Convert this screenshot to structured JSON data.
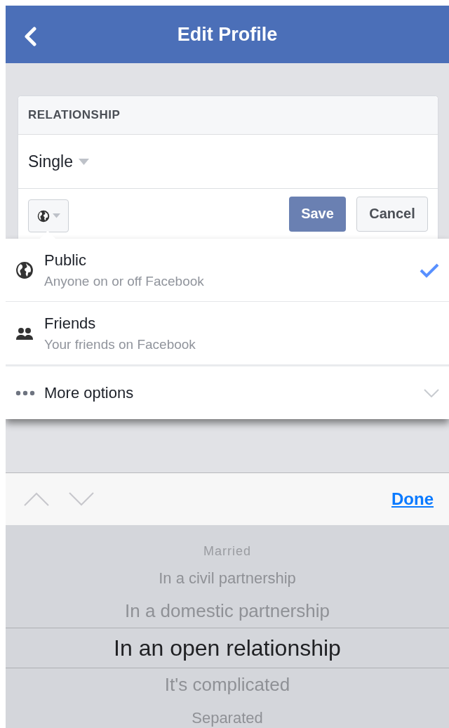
{
  "header": {
    "title": "Edit Profile"
  },
  "section": {
    "title": "RELATIONSHIP",
    "value": "Single",
    "save": "Save",
    "cancel": "Cancel"
  },
  "audience_options": [
    {
      "kind": "public",
      "label": "Public",
      "description": "Anyone on or off Facebook",
      "selected": true
    },
    {
      "kind": "friends",
      "label": "Friends",
      "description": "Your friends on Facebook",
      "selected": false
    },
    {
      "kind": "more",
      "label": "More options",
      "expanded": false
    }
  ],
  "toolbar": {
    "done": "Done"
  },
  "picker": [
    {
      "label": "Married",
      "selected": false
    },
    {
      "label": "In a civil partnership",
      "selected": false
    },
    {
      "label": "In a domestic partnership",
      "selected": false
    },
    {
      "label": "In an open relationship",
      "selected": true
    },
    {
      "label": "It's complicated",
      "selected": false
    },
    {
      "label": "Separated",
      "selected": false
    }
  ]
}
